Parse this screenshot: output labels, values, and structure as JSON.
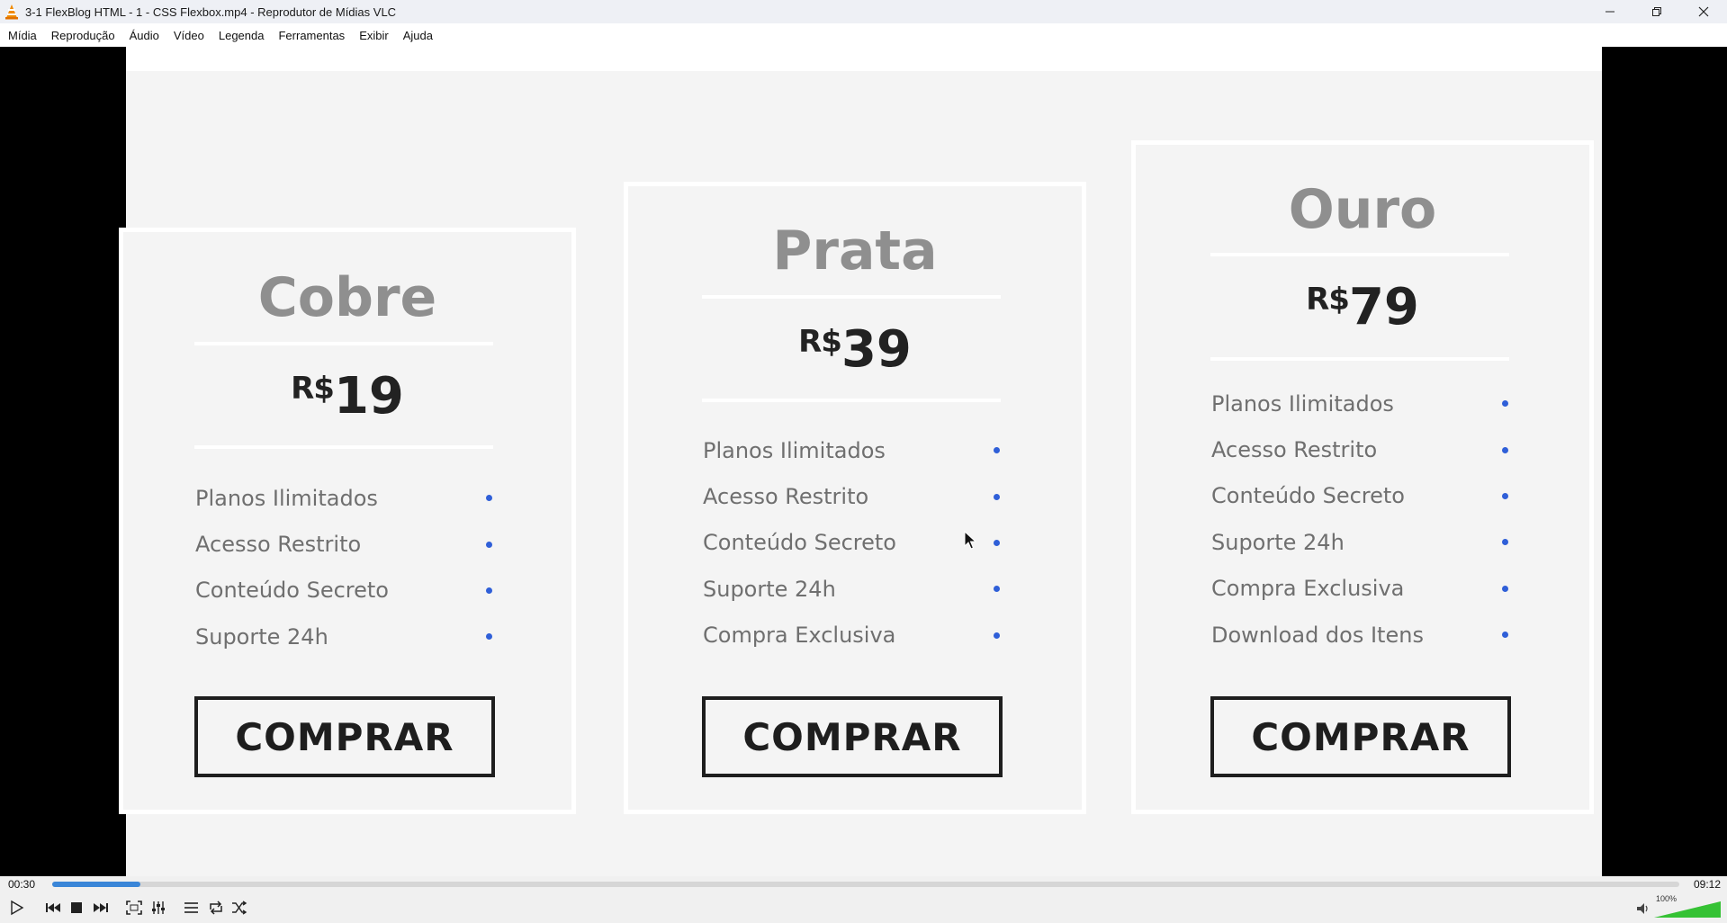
{
  "window": {
    "title": "3-1 FlexBlog HTML - 1 - CSS Flexbox.mp4 - Reprodutor de Mídias VLC",
    "minimize_icon": "minimize-icon",
    "maximize_icon": "restore-icon",
    "close_icon": "close-icon"
  },
  "menu": [
    "Mídia",
    "Reprodução",
    "Áudio",
    "Vídeo",
    "Legenda",
    "Ferramentas",
    "Exibir",
    "Ajuda"
  ],
  "video": {
    "cards": [
      {
        "title": "Cobre",
        "currency": "R$",
        "price": "19",
        "features": [
          "Planos Ilimitados",
          "Acesso Restrito",
          "Conteúdo Secreto",
          "Suporte 24h"
        ],
        "button": "COMPRAR"
      },
      {
        "title": "Prata",
        "currency": "R$",
        "price": "39",
        "features": [
          "Planos Ilimitados",
          "Acesso Restrito",
          "Conteúdo Secreto",
          "Suporte 24h",
          "Compra Exclusiva"
        ],
        "button": "COMPRAR"
      },
      {
        "title": "Ouro",
        "currency": "R$",
        "price": "79",
        "features": [
          "Planos Ilimitados",
          "Acesso Restrito",
          "Conteúdo Secreto",
          "Suporte 24h",
          "Compra Exclusiva",
          "Download dos Itens"
        ],
        "button": "COMPRAR"
      }
    ],
    "bullet_color": "#2f5fd8",
    "title_color": "#8f8f8f"
  },
  "playback": {
    "elapsed": "00:30",
    "total": "09:12",
    "progress": 0.054,
    "volume_label": "100%",
    "volume": 1.0,
    "accent": "#3a86d8"
  },
  "controls": {
    "icons": [
      "play-icon",
      "previous-icon",
      "stop-icon",
      "next-icon",
      "fullscreen-icon",
      "extended-settings-icon",
      "playlist-icon",
      "loop-icon",
      "shuffle-icon",
      "volume-icon"
    ]
  }
}
